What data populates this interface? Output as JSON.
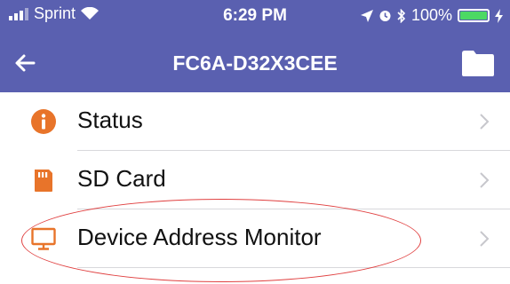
{
  "status_bar": {
    "carrier": "Sprint",
    "time": "6:29 PM",
    "battery": "100%",
    "battery_level": 1.0
  },
  "nav": {
    "title": "FC6A-D32X3CEE",
    "back_icon": "left-arrow",
    "folder_icon": "folder"
  },
  "menu": {
    "items": [
      {
        "label": "Status",
        "icon": "info-circle",
        "icon_color": "#e8742a"
      },
      {
        "label": "SD Card",
        "icon": "sd-card",
        "icon_color": "#e8742a"
      },
      {
        "label": "Device Address Monitor",
        "icon": "monitor",
        "icon_color": "#e8742a"
      }
    ]
  },
  "colors": {
    "header": "#5a60b0",
    "accent": "#e8742a",
    "annotation": "#e04040"
  }
}
